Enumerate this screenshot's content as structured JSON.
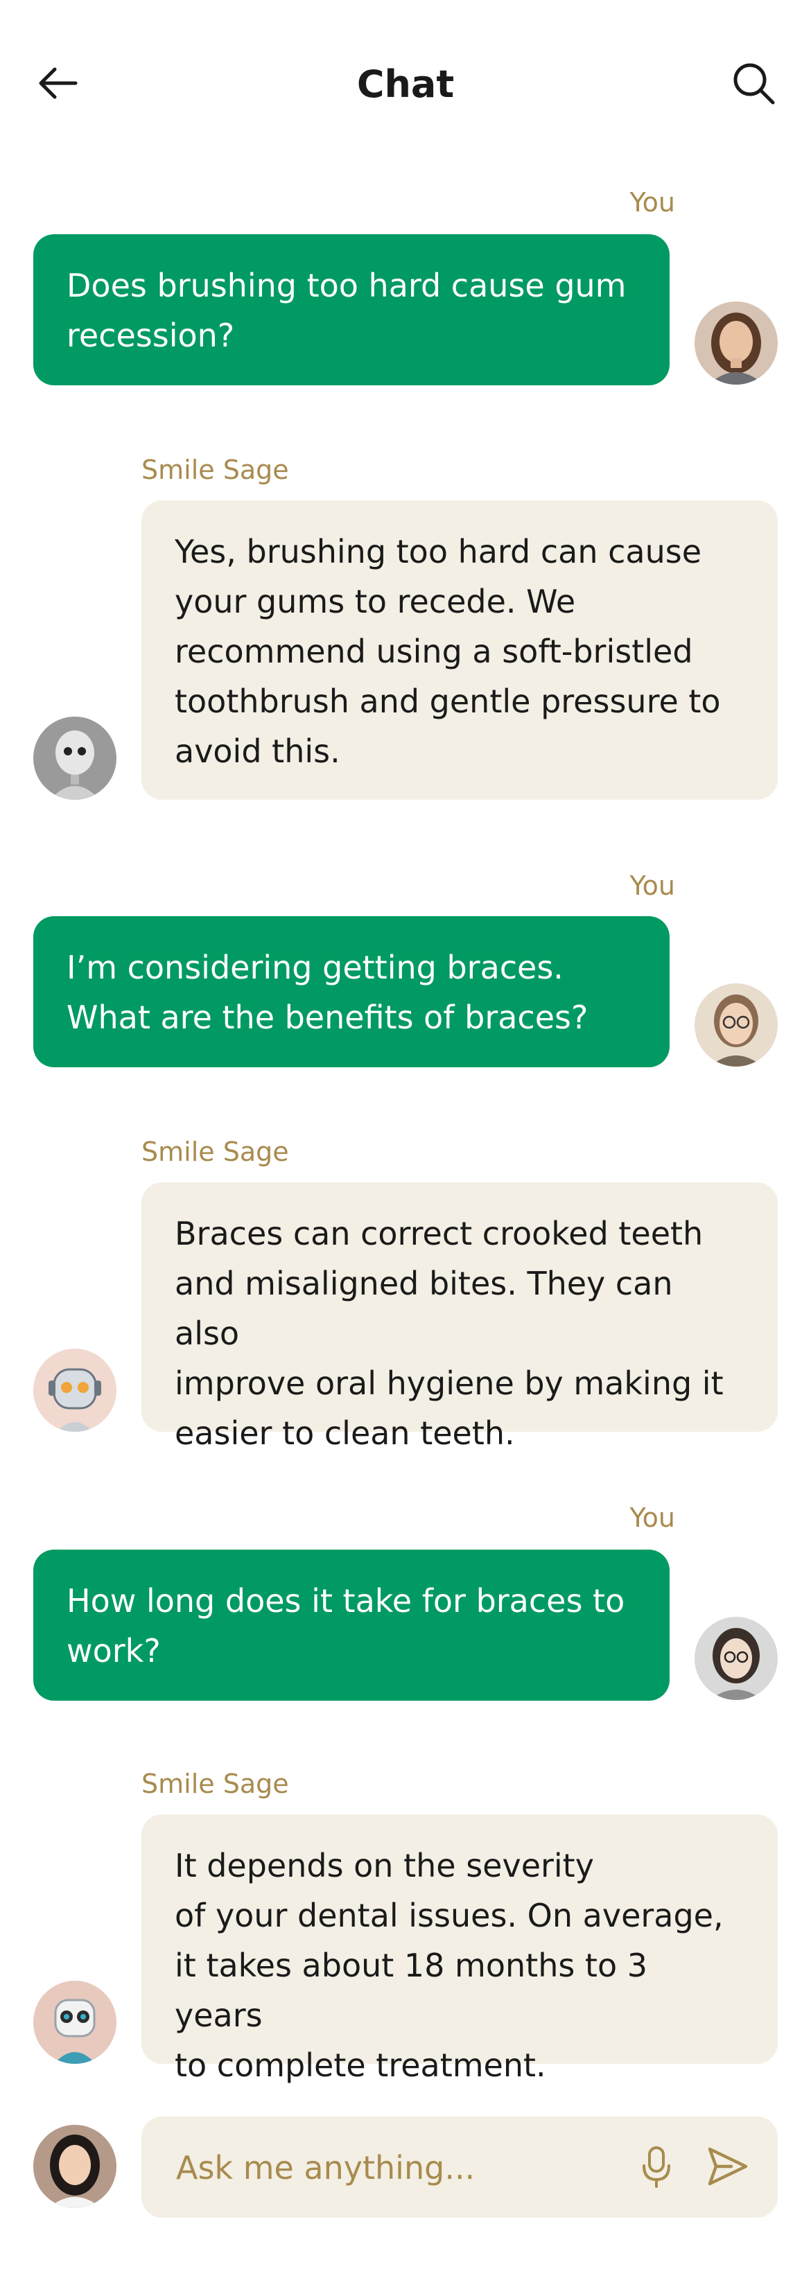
{
  "header": {
    "title": "Chat",
    "back_icon": "arrow-left-icon",
    "search_icon": "search-icon"
  },
  "messages": [
    {
      "role": "user",
      "sender": "You",
      "text": "Does brushing too hard cause gum\nrecession?"
    },
    {
      "role": "bot",
      "sender": "Smile Sage",
      "text": "Yes, brushing too hard can cause\nyour gums to recede. We\nrecommend using a soft-bristled\ntoothbrush and gentle pressure to\navoid this."
    },
    {
      "role": "user",
      "sender": "You",
      "text": "I’m considering getting braces.\nWhat are the benefits of braces?"
    },
    {
      "role": "bot",
      "sender": "Smile Sage",
      "text": "Braces can correct crooked teeth\nand misaligned bites. They can also\n improve oral hygiene by making it\neasier to clean teeth."
    },
    {
      "role": "user",
      "sender": "You",
      "text": "How long does it take for braces to\n work?"
    },
    {
      "role": "bot",
      "sender": "Smile Sage",
      "text": "It depends on the severity\nof your dental issues. On average,\n it takes about 18 months to 3 years\nto complete treatment."
    }
  ],
  "composer": {
    "placeholder": "Ask me anything...",
    "value": "",
    "mic_icon": "microphone-icon",
    "send_icon": "send-icon"
  },
  "colors": {
    "user_bubble": "#009a62",
    "bot_bubble": "#f3efe4",
    "sender_label": "#a88b4e",
    "title": "#1a1a1a"
  }
}
